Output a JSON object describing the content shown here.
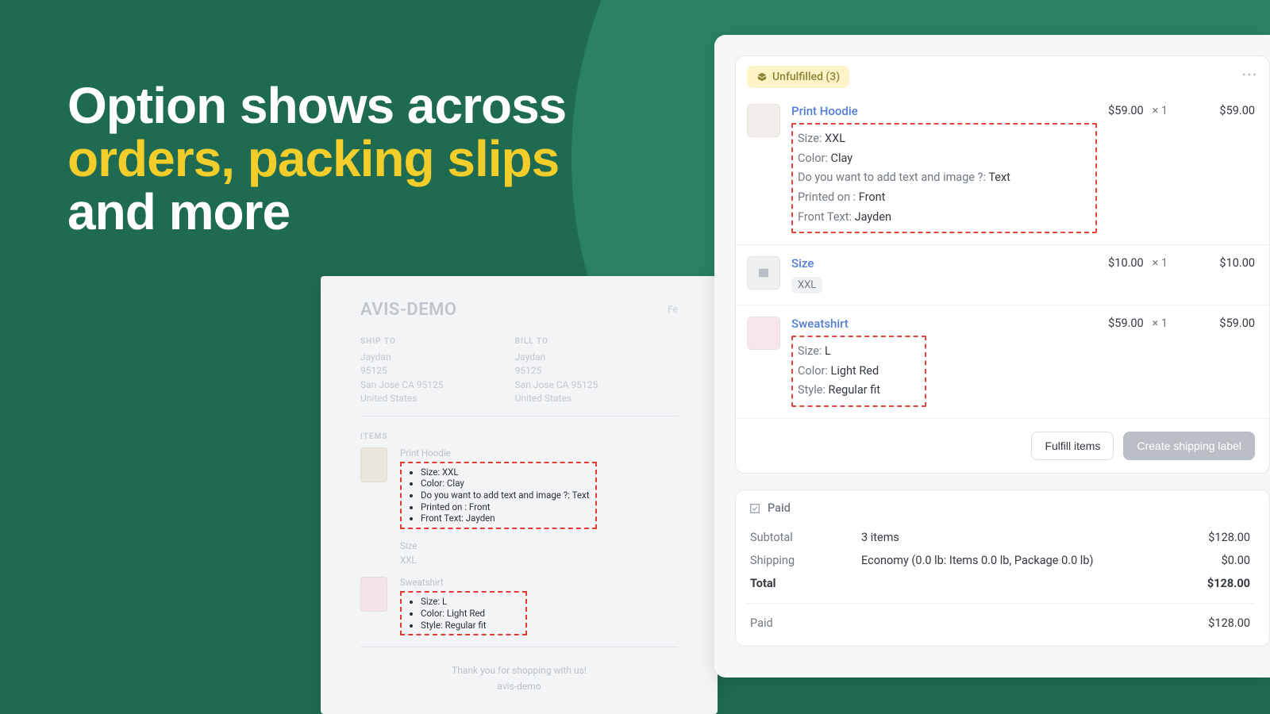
{
  "hero": {
    "line1": "Option shows across",
    "line2": "orders, packing slips",
    "line3": "and more"
  },
  "colors": {
    "accent": "#f3ce2b",
    "danger": "#e03c31",
    "green": "#1f6b52"
  },
  "order": {
    "badge": "Unfulfilled (3)",
    "items": [
      {
        "name": "Print Hoodie",
        "attrs": [
          {
            "k": "Size:",
            "v": " XXL"
          },
          {
            "k": "Color:",
            "v": " Clay"
          },
          {
            "k": "Do you want to add text and image ?:",
            "v": " Text"
          },
          {
            "k": "Printed on :",
            "v": " Front"
          },
          {
            "k": "Front Text:",
            "v": " Jayden"
          }
        ],
        "price": "$59.00",
        "qty": "×  1",
        "total": "$59.00"
      },
      {
        "name": "Size",
        "pill": "XXL",
        "price": "$10.00",
        "qty": "×  1",
        "total": "$10.00"
      },
      {
        "name": "Sweatshirt",
        "attrs": [
          {
            "k": "Size:",
            "v": " L"
          },
          {
            "k": "Color:",
            "v": " Light Red"
          },
          {
            "k": "Style:",
            "v": " Regular fit"
          }
        ],
        "price": "$59.00",
        "qty": "×  1",
        "total": "$59.00"
      }
    ],
    "actions": {
      "fulfill": "Fulfill items",
      "label": "Create shipping label"
    },
    "paid": "Paid",
    "summary": {
      "subtotal_lbl": "Subtotal",
      "subtotal_mid": "3 items",
      "subtotal_amt": "$128.00",
      "ship_lbl": "Shipping",
      "ship_mid": "Economy (0.0 lb: Items 0.0 lb, Package 0.0 lb)",
      "ship_amt": "$0.00",
      "total_lbl": "Total",
      "total_amt": "$128.00",
      "paid_lbl": "Paid",
      "paid_amt": "$128.00"
    }
  },
  "slip": {
    "title": "AVIS-DEMO",
    "date": "Fe",
    "ship_to_h": "SHIP TO",
    "bill_to_h": "BILL TO",
    "address": {
      "name": "Jaydan",
      "zip": "95125",
      "city": "San Jose CA 95125",
      "country": "United States"
    },
    "items_lbl": "ITEMS",
    "items": [
      {
        "name": "Print Hoodie",
        "attrs": [
          "Size: XXL",
          "Color: Clay",
          "Do you want to add text and image ?: Text",
          "Printed on : Front",
          "Front Text: Jayden"
        ]
      },
      {
        "name": "Size",
        "sub": "XXL"
      },
      {
        "name": "Sweatshirt",
        "attrs": [
          "Size: L",
          "Color: Light Red",
          "Style: Regular fit"
        ]
      }
    ],
    "thank": "Thank you for shopping with us!",
    "shop": "avis-demo"
  }
}
